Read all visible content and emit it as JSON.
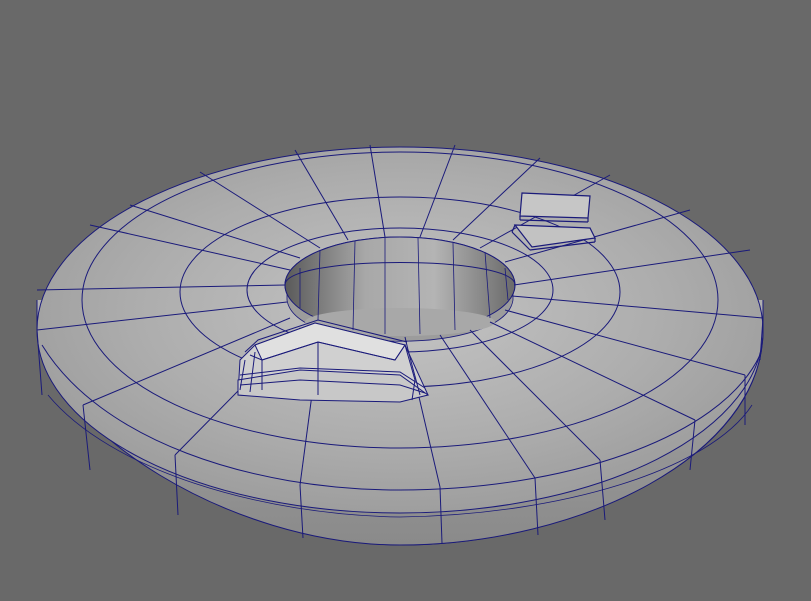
{
  "viewport": {
    "background": "#696969",
    "wire_color": "#1a1a7a",
    "surface_light": "#b8b8b8",
    "surface_mid": "#a2a2a2",
    "surface_dark": "#8a8a8a"
  },
  "objects": [
    {
      "name": "torus-ring-mesh",
      "icon": "ring-mesh"
    },
    {
      "name": "wedge-block-mesh",
      "icon": "wedge-mesh"
    },
    {
      "name": "small-plate-mesh-a",
      "icon": "plate-mesh"
    },
    {
      "name": "small-plate-mesh-b",
      "icon": "plate-mesh"
    }
  ]
}
